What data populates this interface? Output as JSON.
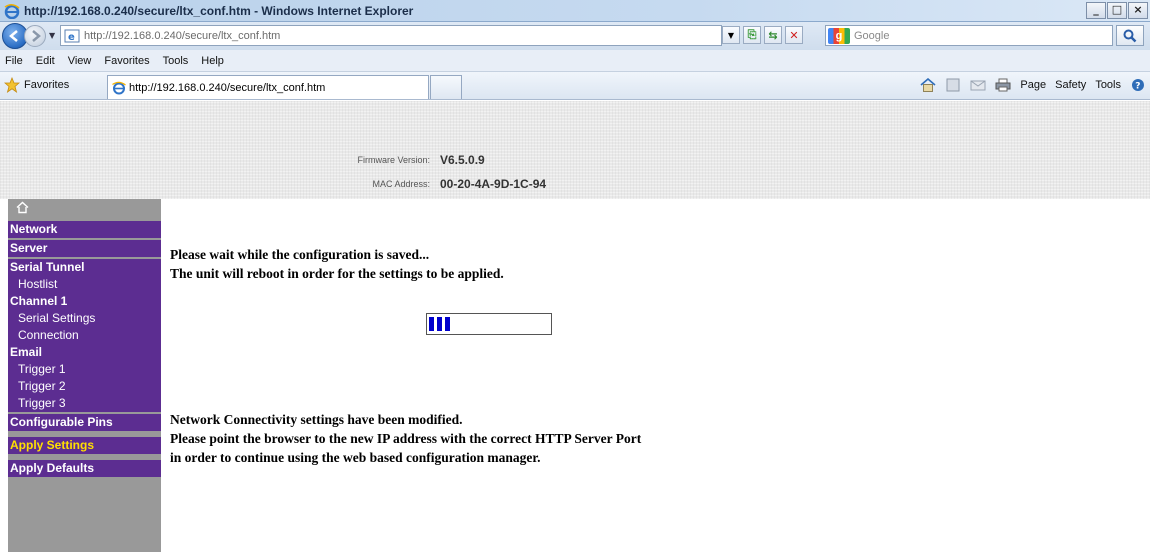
{
  "window": {
    "title": "http://192.168.0.240/secure/ltx_conf.htm - Windows Internet Explorer",
    "min_label": "_",
    "max_label": "□",
    "close_label": "×"
  },
  "address_bar": {
    "url": "http://192.168.0.240/secure/ltx_conf.htm"
  },
  "search": {
    "placeholder": "Google",
    "engine_icon": "google-icon"
  },
  "menu": [
    "File",
    "Edit",
    "View",
    "Favorites",
    "Tools",
    "Help"
  ],
  "favorites_bar": {
    "favorites_label": "Favorites",
    "tab_title": "http://192.168.0.240/secure/ltx_conf.htm",
    "commands": [
      "Page",
      "Safety",
      "Tools"
    ]
  },
  "header": {
    "firmware_label": "Firmware Version:",
    "firmware_value": "V6.5.0.9",
    "mac_label": "MAC Address:",
    "mac_value": "00-20-4A-9D-1C-94"
  },
  "sidebar": {
    "home_icon": "home-icon",
    "groups": [
      {
        "items": [
          {
            "label": "Network",
            "level": "main"
          }
        ]
      },
      {
        "items": [
          {
            "label": "Server",
            "level": "main"
          }
        ]
      },
      {
        "items": [
          {
            "label": "Serial Tunnel",
            "level": "main"
          },
          {
            "label": "Hostlist",
            "level": "sub"
          },
          {
            "label": "Channel 1",
            "level": "main"
          },
          {
            "label": "Serial Settings",
            "level": "sub"
          },
          {
            "label": "Connection",
            "level": "sub"
          },
          {
            "label": "Email",
            "level": "main"
          },
          {
            "label": "Trigger 1",
            "level": "sub"
          },
          {
            "label": "Trigger 2",
            "level": "sub"
          },
          {
            "label": "Trigger 3",
            "level": "sub"
          }
        ]
      },
      {
        "items": [
          {
            "label": "Configurable Pins",
            "level": "main"
          }
        ]
      },
      {
        "items": [
          {
            "label": "Apply Settings",
            "level": "main",
            "highlight": true
          }
        ]
      },
      {
        "items": [
          {
            "label": "Apply Defaults",
            "level": "main"
          }
        ]
      }
    ],
    "colors": {
      "nav_bg": "#5c2d91",
      "sidebar_bg": "#999999",
      "highlight": "#ffe000"
    }
  },
  "main": {
    "wait_lines": [
      "Please wait while the configuration is saved...",
      "The unit will reboot in order for the settings to be applied."
    ],
    "progress_blocks_filled": 3,
    "notice_lines": [
      "Network Connectivity settings have been modified.",
      "Please point the browser to the new IP address with the correct HTTP Server Port",
      "in order to continue using the web based configuration manager."
    ]
  }
}
